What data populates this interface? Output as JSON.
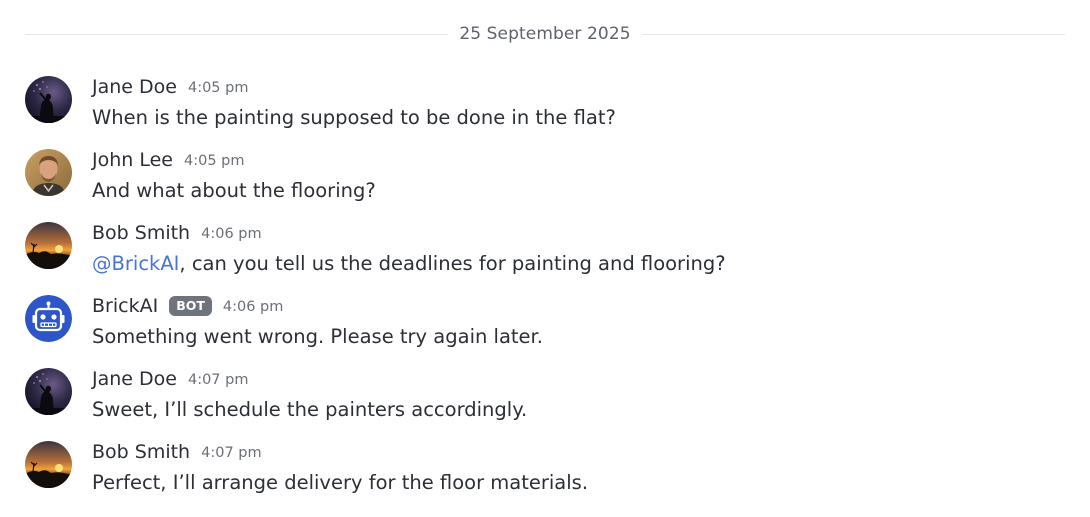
{
  "date_divider": "25 September 2025",
  "messages": [
    {
      "author": "Jane Doe",
      "time": "4:05 pm",
      "text": "When is the painting supposed to be done in the flat?",
      "avatar": "night-silhouette-avatar"
    },
    {
      "author": "John Lee",
      "time": "4:05 pm",
      "text": "And what about the flooring?",
      "avatar": "man-photo-avatar"
    },
    {
      "author": "Bob Smith",
      "time": "4:06 pm",
      "mention": "@BrickAI",
      "text": ", can you tell us the deadlines for painting and flooring?",
      "avatar": "sunset-avatar"
    },
    {
      "author": "BrickAI",
      "badge": "BOT",
      "time": "4:06 pm",
      "text": "Something went wrong. Please try again later.",
      "avatar": "robot-avatar"
    },
    {
      "author": "Jane Doe",
      "time": "4:07 pm",
      "text": "Sweet, I’ll schedule the painters accordingly.",
      "avatar": "night-silhouette-avatar"
    },
    {
      "author": "Bob Smith",
      "time": "4:07 pm",
      "text": "Perfect, I’ll arrange delivery for the floor materials.",
      "avatar": "sunset-avatar"
    }
  ],
  "colors": {
    "mention": "#4a73d6",
    "badge_bg": "#6f737c",
    "robot_bg": "#2f56c8",
    "divider_line": "#e3e5e8"
  }
}
